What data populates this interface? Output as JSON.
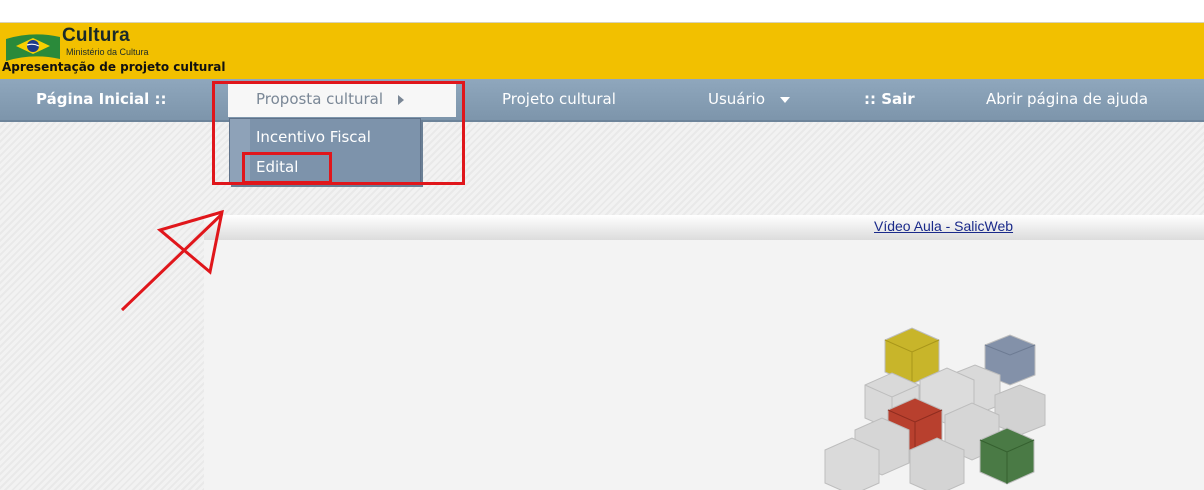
{
  "header": {
    "brand_title": "Cultura",
    "brand_subtitle": "Ministério da Cultura",
    "app_title": "Apresentação de projeto cultural",
    "background_color": "#f2c000"
  },
  "navbar": {
    "items": [
      {
        "label": "Página Inicial ::",
        "bold": true
      },
      {
        "label": "Proposta cultural",
        "active": true,
        "icon": "chevron-right-icon"
      },
      {
        "label": "Projeto cultural"
      },
      {
        "label": "Usuário",
        "icon": "chevron-down-icon"
      },
      {
        "label": ":: Sair",
        "bold": true
      },
      {
        "label": "Abrir página de ajuda"
      }
    ],
    "background_color": "#8fa7bd"
  },
  "submenu": {
    "items": [
      {
        "label": "Incentivo Fiscal"
      },
      {
        "label": "Edital",
        "highlighted": true
      }
    ]
  },
  "content": {
    "link_label": "Vídeo Aula - SalicWeb"
  },
  "annotations": {
    "highlight_color": "#e0161b",
    "arrow_icon": "red-arrow-icon"
  },
  "illustration": {
    "name": "stacked-cubes-icon",
    "colors": [
      "#c8b52a",
      "#b8402e",
      "#4a7a45",
      "#8391a9",
      "#d6d6d6"
    ]
  }
}
